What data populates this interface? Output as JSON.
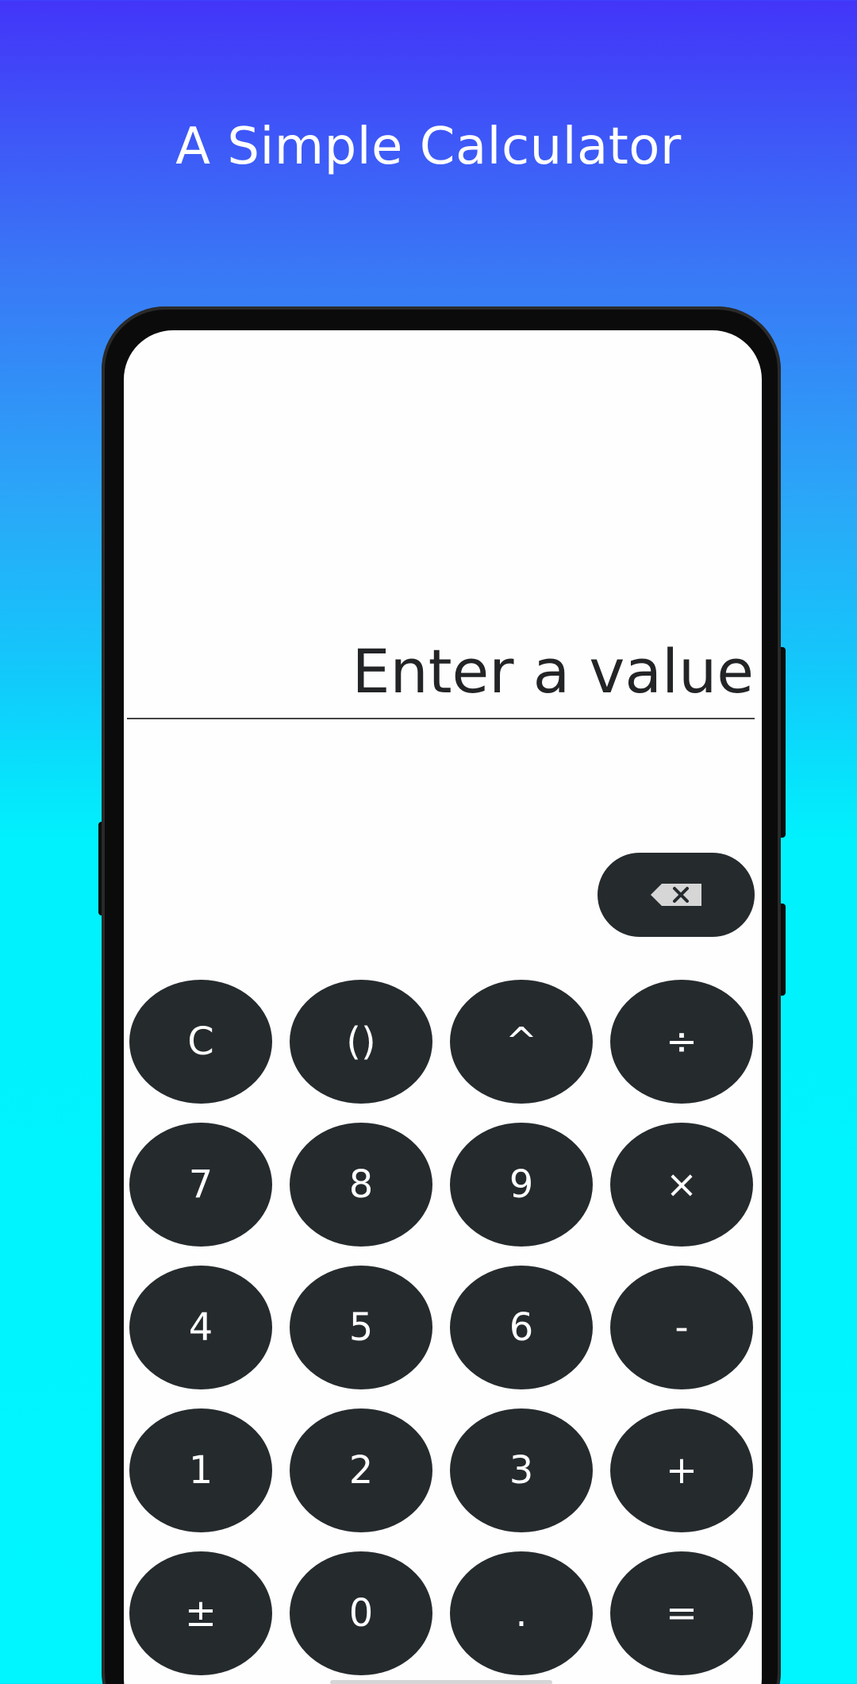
{
  "header": {
    "title": "A Simple Calculator"
  },
  "calculator": {
    "display_placeholder": "Enter a value",
    "backspace_icon": "backspace-icon",
    "keys": [
      [
        "C",
        "()",
        "^",
        "÷"
      ],
      [
        "7",
        "8",
        "9",
        "×"
      ],
      [
        "4",
        "5",
        "6",
        "-"
      ],
      [
        "1",
        "2",
        "3",
        "+"
      ],
      [
        "±",
        "0",
        ".",
        "="
      ]
    ]
  },
  "colors": {
    "gradient_top": "#4335f9",
    "gradient_bottom": "#00f6fe",
    "key_background": "#252a2d",
    "key_text": "#ffffff",
    "screen_background": "#fefefe",
    "display_text": "#222426"
  }
}
